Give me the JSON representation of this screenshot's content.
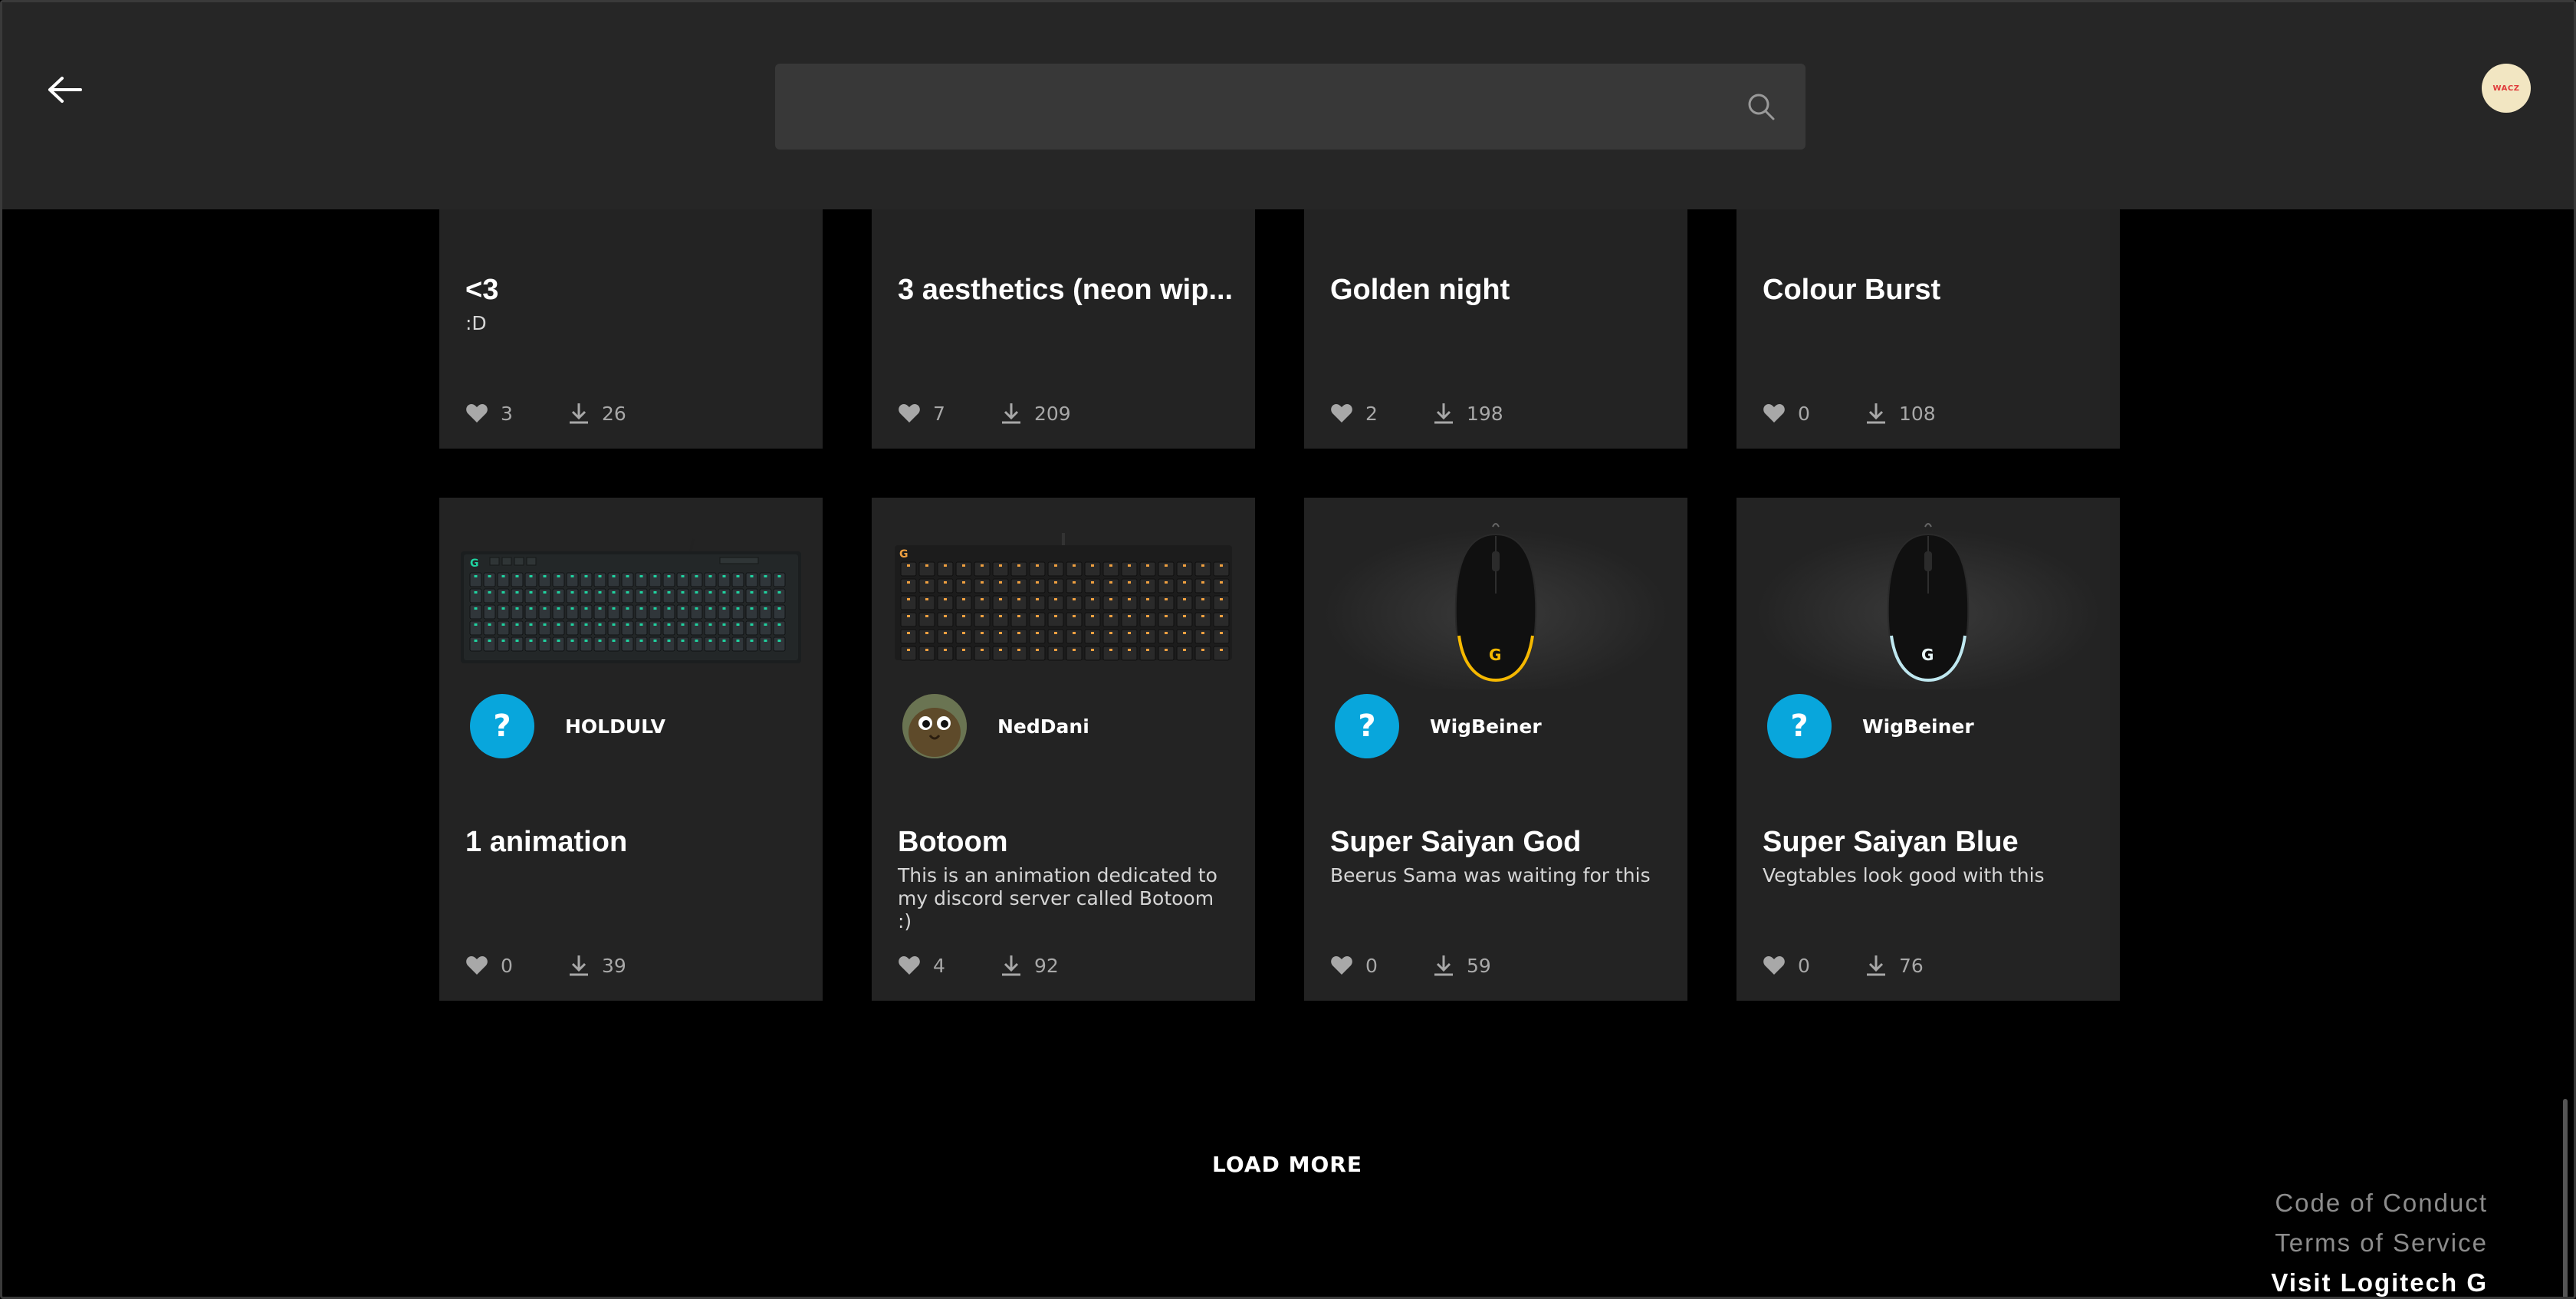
{
  "header": {
    "search_placeholder": "",
    "avatar_text": "WACZ"
  },
  "cards_top": [
    {
      "title": "<3",
      "description": ":D",
      "likes": "3",
      "downloads": "26"
    },
    {
      "title": "3 aesthetics (neon wip...",
      "description": "",
      "likes": "7",
      "downloads": "209"
    },
    {
      "title": "Golden night",
      "description": "",
      "likes": "2",
      "downloads": "198"
    },
    {
      "title": "Colour Burst",
      "description": "",
      "likes": "0",
      "downloads": "108"
    }
  ],
  "cards_bottom": [
    {
      "author": "HOLDULV",
      "author_avatar": "?",
      "title": "1 animation",
      "description": "",
      "likes": "0",
      "downloads": "39",
      "device": "keyboard-full",
      "accent": "#1fd3a0"
    },
    {
      "author": "NedDani",
      "author_avatar": "",
      "title": "Botoom",
      "description": "This is an animation dedicated to my discord server called Botoom :)",
      "likes": "4",
      "downloads": "92",
      "device": "keyboard-tkl",
      "accent": "#f0a040"
    },
    {
      "author": "WigBeiner",
      "author_avatar": "?",
      "title": "Super Saiyan God",
      "description": "Beerus Sama was waiting for this",
      "likes": "0",
      "downloads": "59",
      "device": "mouse",
      "accent": "#f5b800"
    },
    {
      "author": "WigBeiner",
      "author_avatar": "?",
      "title": "Super Saiyan Blue",
      "description": "Vegtables look good with this",
      "likes": "0",
      "downloads": "76",
      "device": "mouse",
      "accent": "#bfe8f0"
    }
  ],
  "load_more": "LOAD MORE",
  "footer": {
    "code_of_conduct": "Code of Conduct",
    "terms": "Terms of Service",
    "visit": "Visit Logitech G"
  },
  "colors": {
    "background": "#000000",
    "header": "#262626",
    "card": "#232323",
    "author_badge": "#08a6dc"
  }
}
